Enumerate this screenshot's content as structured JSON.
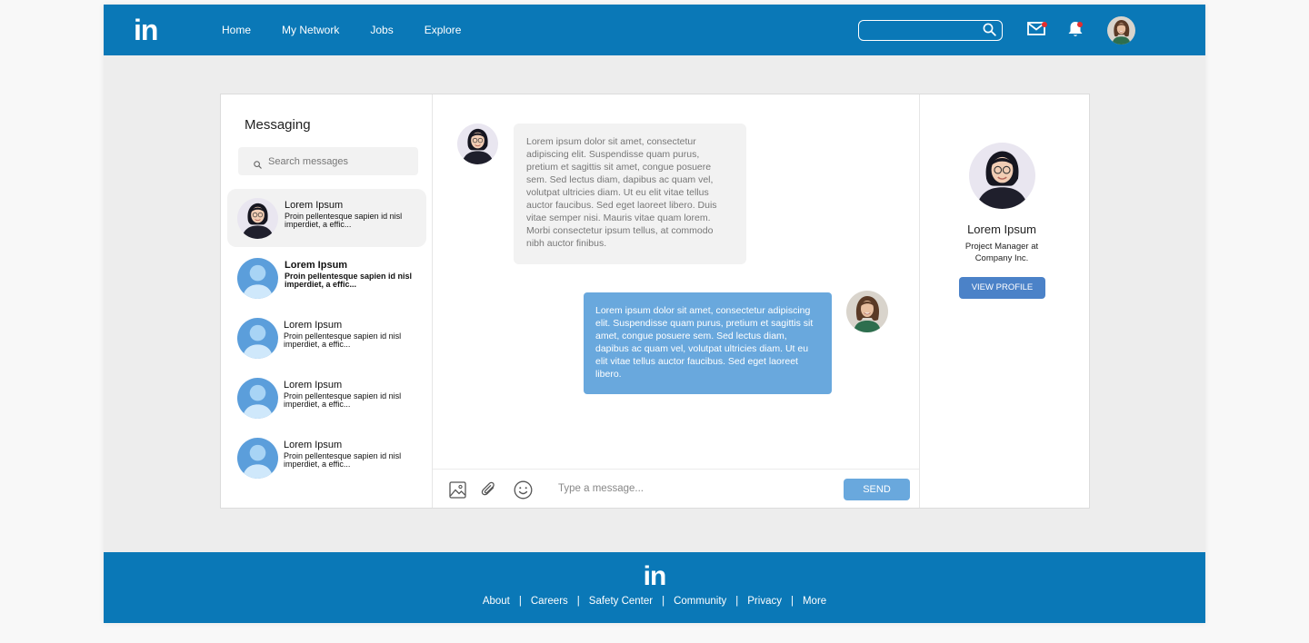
{
  "header": {
    "logo": "in",
    "nav": [
      "Home",
      "My Network",
      "Jobs",
      "Explore"
    ],
    "search_value": ""
  },
  "messaging": {
    "title": "Messaging",
    "search_placeholder": "Search messages",
    "conversations": [
      {
        "name": "Lorem Ipsum",
        "preview": "Proin pellentesque sapien id nisl imperdiet, a effic...",
        "active": true,
        "unread": false
      },
      {
        "name": "Lorem Ipsum",
        "preview": "Proin pellentesque sapien id nisl imperdiet, a effic...",
        "active": false,
        "unread": true
      },
      {
        "name": "Lorem Ipsum",
        "preview": "Proin pellentesque sapien id nisl imperdiet, a effic...",
        "active": false,
        "unread": false
      },
      {
        "name": "Lorem Ipsum",
        "preview": "Proin pellentesque sapien id nisl imperdiet, a effic...",
        "active": false,
        "unread": false
      },
      {
        "name": "Lorem Ipsum",
        "preview": "Proin pellentesque sapien id nisl imperdiet, a effic...",
        "active": false,
        "unread": false
      }
    ]
  },
  "chat": {
    "incoming": "Lorem ipsum dolor sit amet, consectetur adipiscing elit. Suspendisse quam purus, pretium et sagittis sit amet, congue posuere sem. Sed lectus diam, dapibus ac quam vel, volutpat ultricies diam. Ut eu elit vitae tellus auctor faucibus. Sed eget laoreet libero. Duis vitae semper nisi. Mauris vitae quam lorem. Morbi consectetur ipsum tellus, at commodo nibh auctor finibus.",
    "outgoing": "Lorem ipsum dolor sit amet, consectetur adipiscing elit. Suspendisse quam purus, pretium et sagittis sit amet, congue posuere sem. Sed lectus diam, dapibus ac quam vel, volutpat ultricies diam. Ut eu elit vitae tellus auctor faucibus. Sed eget laoreet libero.",
    "composer_placeholder": "Type a message...",
    "send_label": "SEND"
  },
  "profile": {
    "name": "Lorem Ipsum",
    "title": "Project Manager at Company Inc.",
    "button": "VIEW PROFILE"
  },
  "footer": {
    "logo": "in",
    "links": [
      "About",
      "Careers",
      "Safety Center",
      "Community",
      "Privacy",
      "More"
    ],
    "separator": "|"
  },
  "colors": {
    "brand": "#0a78b7",
    "bubble_out": "#69a8dd",
    "bubble_in": "#f2f2f2",
    "button": "#4b82c8",
    "notification_dot": "#e52d2d"
  },
  "icons": [
    "search-icon",
    "mail-icon",
    "bell-icon",
    "image-icon",
    "paperclip-icon",
    "emoji-icon"
  ]
}
